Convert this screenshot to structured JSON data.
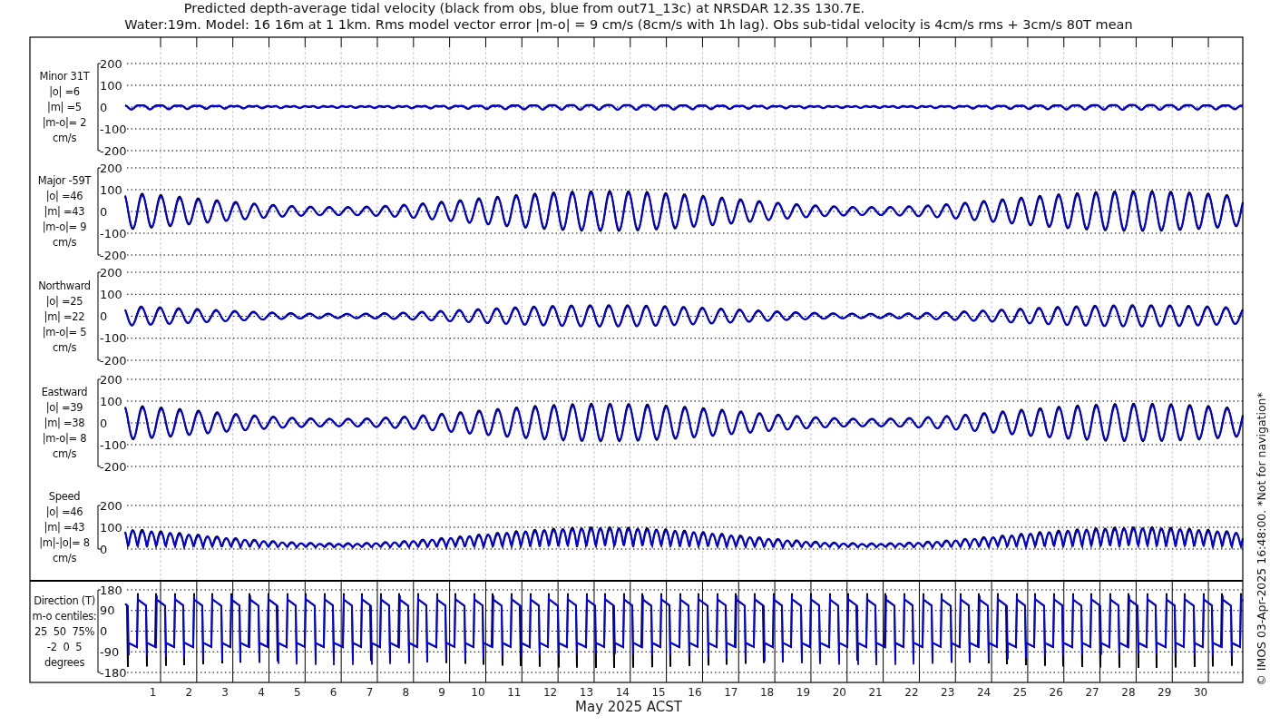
{
  "title": "Predicted depth-average tidal velocity (black from obs, blue from out71_13c) at NRSDAR 12.3S 130.7E.",
  "subtitle": "Water:19m. Model: 16 16m at 1 1km. Rms model vector error |m-o| = 9 cm/s (8cm/s with 1h lag). Obs sub-tidal velocity is 4cm/s rms + 3cm/s 80T mean",
  "panels": [
    {
      "kind": "velocity",
      "label_lines": [
        "Minor 31T",
        "|o| =6",
        "|m| =5",
        "|m-o|= 2",
        "cm/s"
      ],
      "yticks": [
        "200",
        "100",
        "0",
        "-100",
        "-200"
      ]
    },
    {
      "kind": "velocity",
      "label_lines": [
        "Major -59T",
        "|o| =46",
        "|m| =43",
        "|m-o|= 9",
        "cm/s"
      ],
      "yticks": [
        "200",
        "100",
        "0",
        "-100",
        "-200"
      ]
    },
    {
      "kind": "velocity",
      "label_lines": [
        "Northward",
        "|o| =25",
        "|m| =22",
        "|m-o|= 5",
        "cm/s"
      ],
      "yticks": [
        "200",
        "100",
        "0",
        "-100",
        "-200"
      ]
    },
    {
      "kind": "velocity",
      "label_lines": [
        "Eastward",
        "|o| =39",
        "|m| =38",
        "|m-o|= 8",
        "cm/s"
      ],
      "yticks": [
        "200",
        "100",
        "0",
        "-100",
        "-200"
      ]
    },
    {
      "kind": "speed",
      "label_lines": [
        "Speed",
        "|o| =46",
        "|m| =43",
        "|m|-|o|= 8",
        "cm/s"
      ],
      "yticks": [
        "200",
        "100",
        "0"
      ]
    },
    {
      "kind": "direction",
      "label_lines": [
        "Direction (T)",
        "m-o centiles:",
        "25  50  75%",
        "-2  0  5",
        "degrees"
      ],
      "yticks": [
        "180",
        "90",
        "0",
        "-90",
        "-180"
      ]
    }
  ],
  "x_ticks": [
    "1",
    "2",
    "3",
    "4",
    "5",
    "6",
    "7",
    "8",
    "9",
    "10",
    "11",
    "12",
    "13",
    "14",
    "15",
    "16",
    "17",
    "18",
    "19",
    "20",
    "21",
    "22",
    "23",
    "24",
    "25",
    "26",
    "27",
    "28",
    "29",
    "30"
  ],
  "x_label": "May 2025 ACST",
  "footer_note": "© IMOS 03-Apr-2025 16:48:00. *Not for navigation*"
}
